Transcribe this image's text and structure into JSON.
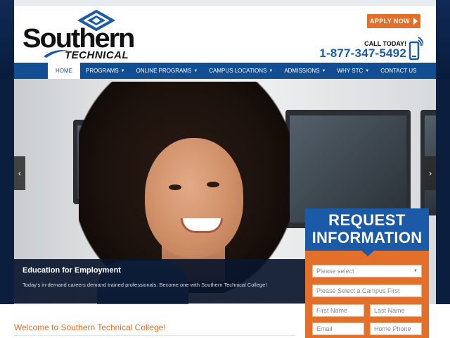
{
  "header": {
    "logo_main": "Southern",
    "logo_sub": "TECHNICAL COLLEGE",
    "apply_label": "APPLY NOW",
    "call_label": "CALL TODAY!",
    "phone": "1-877-347-5492"
  },
  "nav": {
    "items": [
      {
        "label": "HOME",
        "active": true,
        "dropdown": false
      },
      {
        "label": "PROGRAMS",
        "active": false,
        "dropdown": true
      },
      {
        "label": "ONLINE PROGRAMS",
        "active": false,
        "dropdown": true
      },
      {
        "label": "CAMPUS LOCATIONS",
        "active": false,
        "dropdown": true
      },
      {
        "label": "ADMISSIONS",
        "active": false,
        "dropdown": true
      },
      {
        "label": "WHY STC",
        "active": false,
        "dropdown": true
      },
      {
        "label": "CONTACT US",
        "active": false,
        "dropdown": false
      }
    ]
  },
  "hero": {
    "prev_label": "‹",
    "next_label": "›",
    "caption_title": "Education for Employment",
    "caption_text": "Today's in-demand careers demand trained professionals. Become one with Southern Technical College!"
  },
  "request": {
    "title_line1": "REQUEST",
    "title_line2": "INFORMATION",
    "program_placeholder": "Please select",
    "campus_placeholder": "Please Select a Campus First",
    "first_name_placeholder": "First Name",
    "last_name_placeholder": "Last Name",
    "email_placeholder": "Email",
    "home_phone_placeholder": "Home Phone"
  },
  "main": {
    "welcome_title": "Welcome to Southern Technical College!"
  },
  "colors": {
    "brand_blue": "#124e91",
    "accent_orange": "#e2702a",
    "phone_blue": "#1b5aa6",
    "dark_navy": "#0b1e3e"
  }
}
